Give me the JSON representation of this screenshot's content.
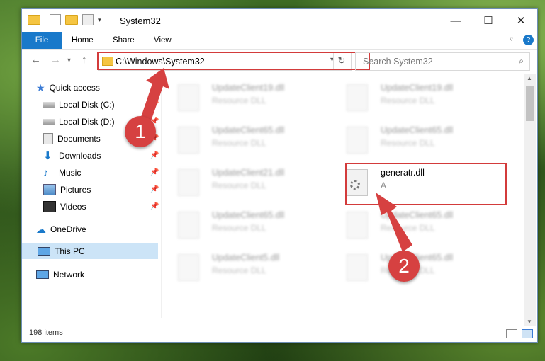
{
  "window": {
    "title": "System32"
  },
  "ribbon": {
    "tabs": [
      "File",
      "Home",
      "Share",
      "View"
    ]
  },
  "address": {
    "path": "C:\\Windows\\System32",
    "search_placeholder": "Search System32"
  },
  "sidebar": {
    "quick_access": "Quick access",
    "items": [
      {
        "label": "Local Disk (C:)",
        "icon": "drive-icon",
        "pinned": true
      },
      {
        "label": "Local Disk (D:)",
        "icon": "drive-icon",
        "pinned": true
      },
      {
        "label": "Documents",
        "icon": "documents-icon",
        "pinned": true
      },
      {
        "label": "Downloads",
        "icon": "downloads-icon",
        "pinned": true
      },
      {
        "label": "Music",
        "icon": "music-icon",
        "pinned": true
      },
      {
        "label": "Pictures",
        "icon": "pictures-icon",
        "pinned": true
      },
      {
        "label": "Videos",
        "icon": "videos-icon",
        "pinned": true
      }
    ],
    "onedrive": "OneDrive",
    "this_pc": "This PC",
    "network": "Network"
  },
  "files": [
    {
      "name": "UpdateClient19.dll",
      "sub": "Resource DLL"
    },
    {
      "name": "UpdateClient19.dll",
      "sub": "Resource DLL"
    },
    {
      "name": "UpdateClient65.dll",
      "sub": "Resource DLL"
    },
    {
      "name": "UpdateClient65.dll",
      "sub": "Resource DLL"
    },
    {
      "name": "UpdateClient21.dll",
      "sub": "Resource DLL"
    },
    {
      "name": "generatr.dll",
      "sub": "A"
    },
    {
      "name": "UpdateClient65.dll",
      "sub": "Resource DLL"
    },
    {
      "name": "UpdateClient65.dll",
      "sub": "Resource DLL"
    },
    {
      "name": "UpdateClient5.dll",
      "sub": "Resource DLL"
    },
    {
      "name": "UpdateClient65.dll",
      "sub": "Resource DLL"
    }
  ],
  "status": {
    "count": "198 items"
  },
  "annotations": {
    "step1": "1",
    "step2": "2",
    "color": "#d64141"
  }
}
